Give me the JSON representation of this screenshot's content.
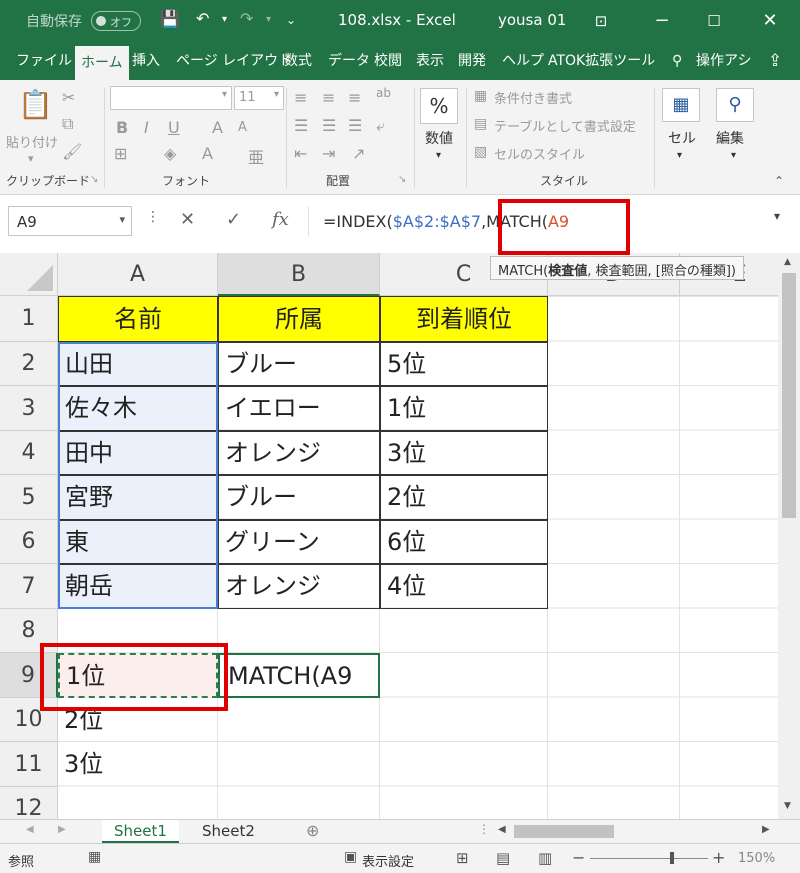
{
  "titlebar": {
    "autosave": "自動保存",
    "autosave_state": "オフ",
    "title": "108.xlsx  -  Excel",
    "user": "yousa 01"
  },
  "tabs": [
    "ファイル",
    "ホーム",
    "挿入",
    "ページ レイアウト",
    "数式",
    "データ",
    "校閲",
    "表示",
    "開発",
    "ヘルプ",
    "ATOK拡張ツール",
    "操作アシ"
  ],
  "ribbon": {
    "paste": "貼り付け",
    "font_size": "11",
    "clipboard": "クリップボード",
    "font": "フォント",
    "alignment": "配置",
    "number": "数値",
    "cond_format": "条件付き書式",
    "table_format": "テーブルとして書式設定",
    "cell_style": "セルのスタイル",
    "style": "スタイル",
    "cells": "セル",
    "editing": "編集"
  },
  "formula_bar": {
    "name_box": "A9",
    "formula_prefix": "=INDEX(",
    "formula_ref": "$A$2:$A$7",
    "formula_mid": ",MATCH(",
    "formula_arg": "A9",
    "tooltip_func": "MATCH(",
    "tooltip_bold": "検査値",
    "tooltip_rest": ", 検査範囲, [照合の種類])"
  },
  "grid": {
    "columns": [
      "A",
      "B",
      "C",
      "D",
      "E"
    ],
    "rows": [
      "1",
      "2",
      "3",
      "4",
      "5",
      "6",
      "7",
      "8",
      "9",
      "10",
      "11",
      "12"
    ],
    "header": [
      "名前",
      "所属",
      "到着順位"
    ],
    "data": [
      [
        "山田",
        "ブルー",
        "5位"
      ],
      [
        "佐々木",
        "イエロー",
        "1位"
      ],
      [
        "田中",
        "オレンジ",
        "3位"
      ],
      [
        "宮野",
        "ブルー",
        "2位"
      ],
      [
        "東",
        "グリーン",
        "6位"
      ],
      [
        "朝岳",
        "オレンジ",
        "4位"
      ]
    ],
    "a9": "1位",
    "b9": "MATCH(A9",
    "a10": "2位",
    "a11": "3位"
  },
  "sheets": [
    "Sheet1",
    "Sheet2"
  ],
  "status": {
    "mode": "参照",
    "display_settings": "表示設定",
    "zoom": "150%"
  }
}
